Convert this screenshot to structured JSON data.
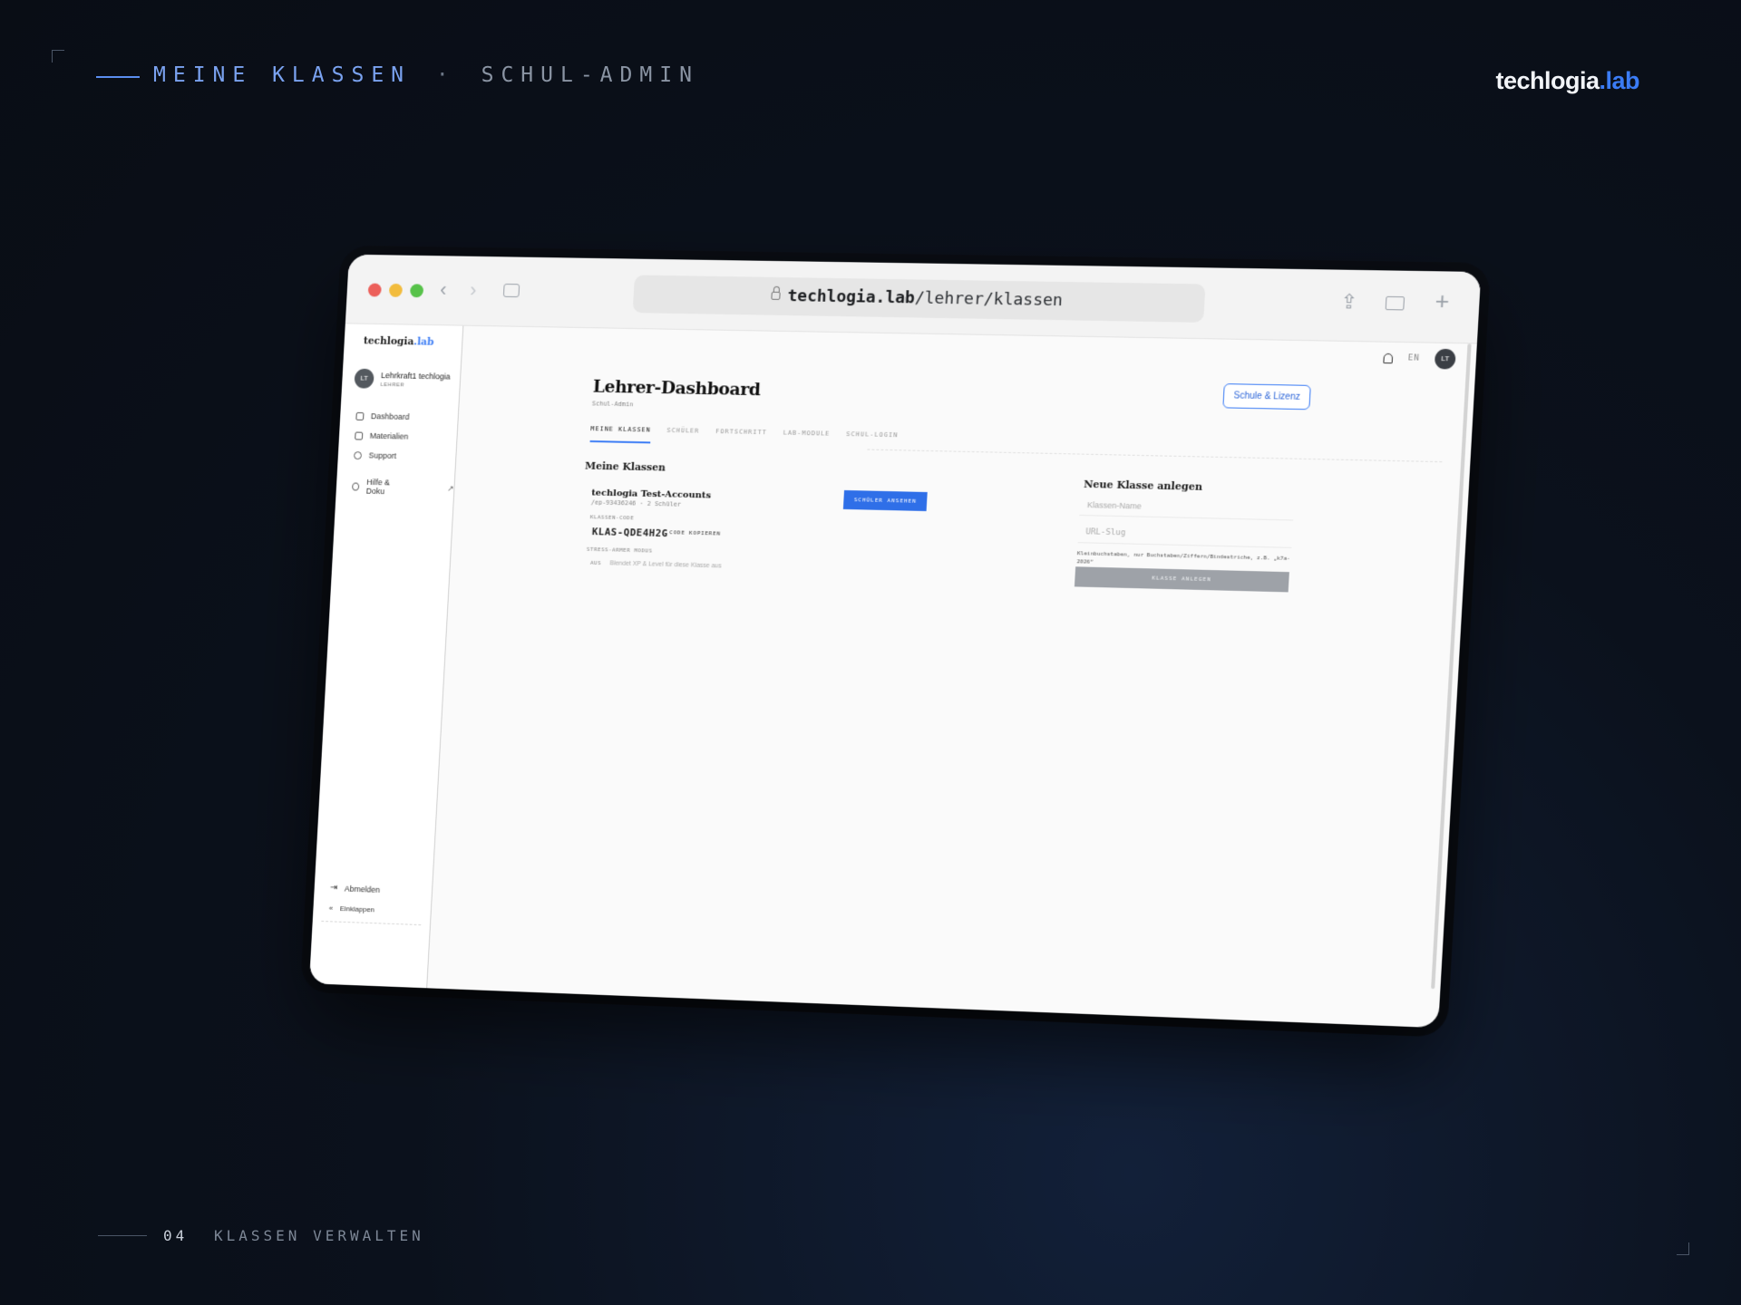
{
  "slide": {
    "title_main": "MEINE KLASSEN",
    "title_sep": "·",
    "title_sub": "SCHUL-ADMIN",
    "brand_main": "techlogia",
    "brand_accent": ".lab",
    "page_number": "04",
    "page_label": "KLASSEN VERWALTEN",
    "accent_color": "#3b7cf5"
  },
  "browser": {
    "url_host": "techlogia.lab",
    "url_path": "/lehrer/klassen"
  },
  "app": {
    "lang": "EN",
    "avatar_initials": "LT",
    "sidebar": {
      "logo_main": "techlogia",
      "logo_accent": ".lab",
      "user_initials": "LT",
      "user_name": "Lehrkraft1 techlogia",
      "user_role": "LEHRER",
      "items": [
        {
          "label": "Dashboard",
          "icon": "grid-icon"
        },
        {
          "label": "Materialien",
          "icon": "document-icon"
        },
        {
          "label": "Support",
          "icon": "chat-icon"
        },
        {
          "label": "Hilfe & Doku",
          "icon": "help-icon"
        }
      ],
      "logout_label": "Abmelden",
      "collapse_label": "Einklappen"
    },
    "header": {
      "title": "Lehrer-Dashboard",
      "subtitle": "Schul-Admin",
      "school_button": "Schule & Lizenz"
    },
    "tabs": [
      {
        "label": "MEINE KLASSEN",
        "active": true
      },
      {
        "label": "SCHÜLER",
        "active": false
      },
      {
        "label": "FORTSCHRITT",
        "active": false
      },
      {
        "label": "LAB-MODULE",
        "active": false
      },
      {
        "label": "SCHUL-LOGIN",
        "active": false
      }
    ],
    "classes_section": {
      "title": "Meine Klassen",
      "class_name": "techlogia Test-Accounts",
      "class_meta": "/ep-93436246 · 2 Schüler",
      "view_button": "SCHÜLER ANSEHEN",
      "code_label": "KLASSEN-CODE",
      "code_value": "KLAS-QDE4H2G",
      "copy_button": "CODE KOPIEREN",
      "stress_label": "STRESS-ARMER MODUS",
      "toggle_state": "AUS",
      "toggle_desc": "Blendet XP & Level für diese Klasse aus"
    },
    "new_class": {
      "title": "Neue Klasse anlegen",
      "name_placeholder": "Klassen-Name",
      "slug_placeholder": "URL-Slug",
      "hint": "Kleinbuchstaben, nur Buchstaben/Ziffern/Bindestriche, z.B. „k7a-2026“",
      "create_button": "KLASSE ANLEGEN"
    }
  }
}
